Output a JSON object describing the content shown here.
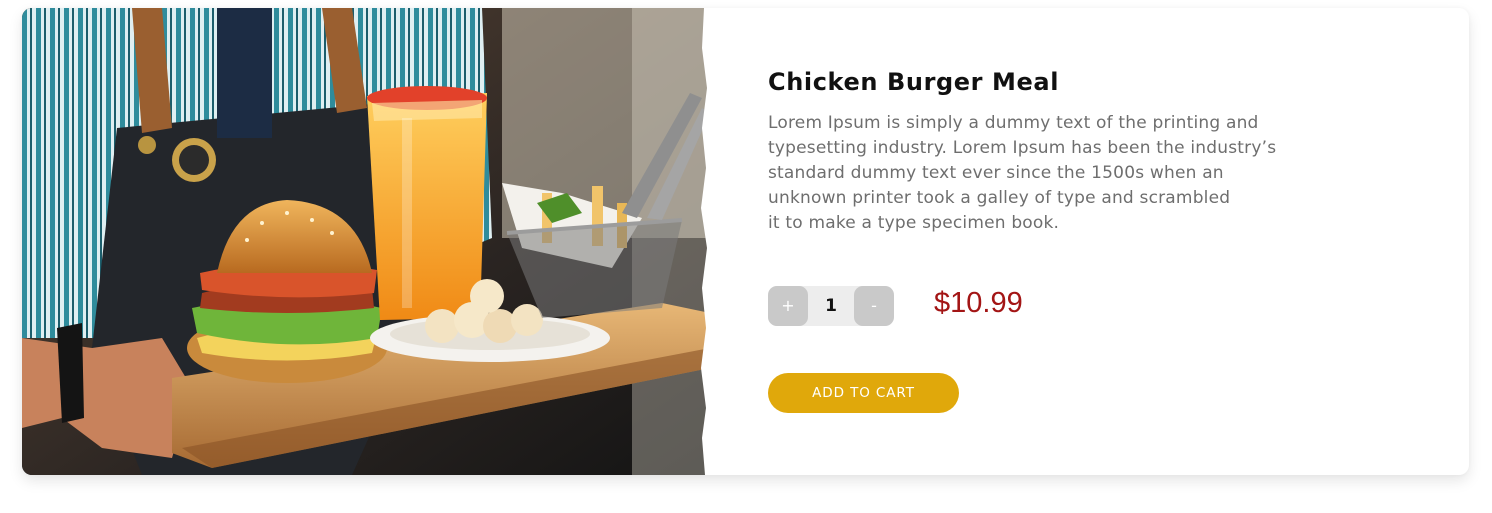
{
  "product": {
    "image_alt": "Waiter holding a tray with a burger, orange juice, fries and potatoes",
    "title": "Chicken Burger Meal",
    "description_lines": [
      "Lorem Ipsum is simply a dummy text of the printing and",
      "typesetting industry. Lorem Ipsum has been the industry’s",
      "standard dummy text ever since the 1500s when an",
      "unknown printer took a galley of type and scrambled",
      "it to make a type specimen book."
    ],
    "price": "$10.99"
  },
  "quantity": {
    "increase_label": "+",
    "value": "1",
    "decrease_label": "-"
  },
  "cart": {
    "add_label": "ADD TO CART"
  },
  "colors": {
    "accent": "#e0a80b",
    "price": "#a31515",
    "title": "#111111",
    "body_text": "#6e6e6e",
    "stepper_bg": "#ededed",
    "stepper_button": "#c9c9c9"
  }
}
